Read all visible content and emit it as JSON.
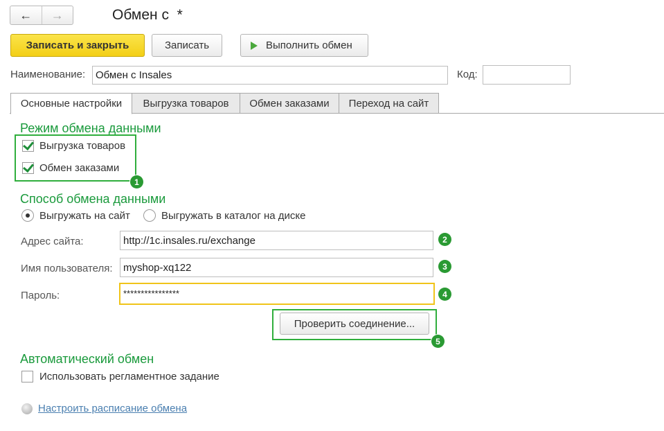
{
  "nav": {
    "back_icon": "arrow-left-icon",
    "forward_icon": "arrow-right-icon",
    "back_glyph": "←",
    "forward_glyph": "→"
  },
  "window": {
    "title": "Обмен с  *"
  },
  "toolbar": {
    "save_close": "Записать и закрыть",
    "save": "Записать",
    "execute": "Выполнить обмен"
  },
  "name_row": {
    "name_label": "Наименование:",
    "name_value": "Обмен с Insales",
    "code_label": "Код:",
    "code_value": ""
  },
  "tabs": [
    {
      "label": "Основные настройки",
      "active": true
    },
    {
      "label": "Выгрузка товаров",
      "active": false
    },
    {
      "label": "Обмен заказами",
      "active": false
    },
    {
      "label": "Переход на сайт",
      "active": false
    }
  ],
  "mode": {
    "title": "Режим обмена данными",
    "export_goods": {
      "label": "Выгрузка товаров",
      "checked": true
    },
    "exchange_orders": {
      "label": "Обмен заказами",
      "checked": true
    }
  },
  "method": {
    "title": "Способ обмена данными",
    "radio_site": {
      "label": "Выгружать на сайт",
      "selected": true
    },
    "radio_disk": {
      "label": "Выгружать в каталог на диске",
      "selected": false
    },
    "site_label": "Адрес сайта:",
    "site_value": "http://1c.insales.ru/exchange",
    "user_label": "Имя пользователя:",
    "user_value": "myshop-xq122",
    "password_label": "Пароль:",
    "password_value": "****************",
    "check_button": "Проверить соединение..."
  },
  "auto": {
    "title": "Автоматический обмен",
    "use_job": {
      "label": "Использовать регламентное задание",
      "checked": false
    },
    "schedule_link": "Настроить расписание обмена"
  },
  "badges": [
    "1",
    "2",
    "3",
    "4",
    "5"
  ],
  "colors": {
    "accent_green": "#1a9a3c",
    "frame_green": "#2fae3c",
    "primary_yellow": "#f3cf17",
    "focus_yellow": "#f0c419",
    "link_blue": "#4a7fb0"
  }
}
